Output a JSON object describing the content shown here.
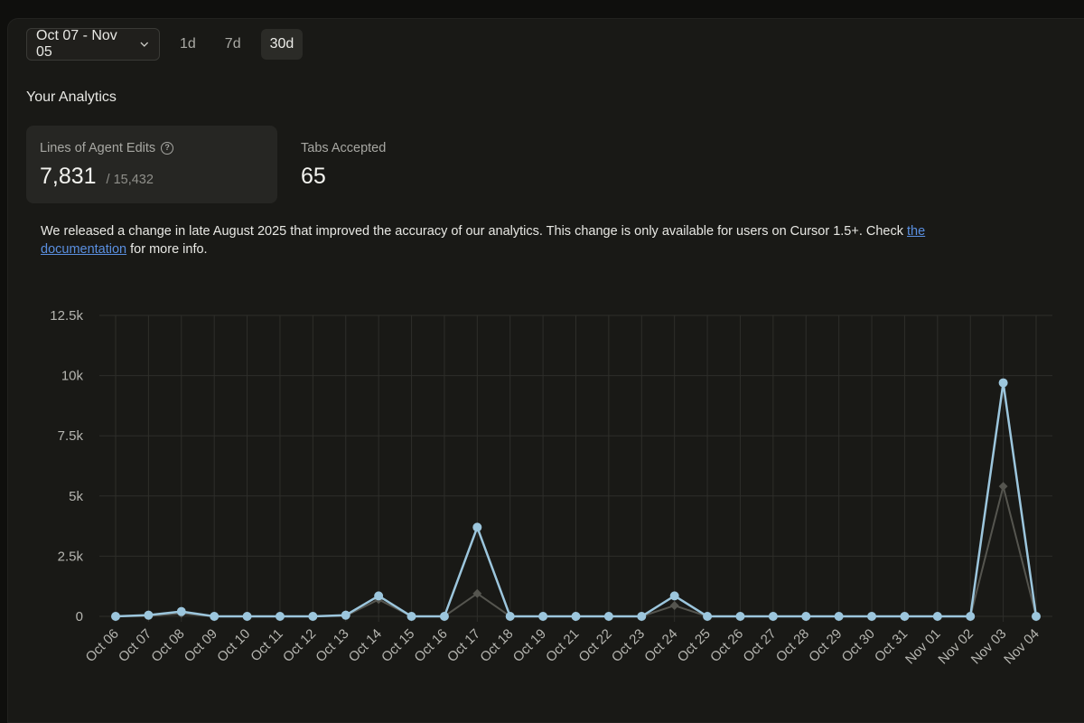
{
  "toolbar": {
    "range_label": "Oct 07 - Nov 05",
    "periods": [
      "1d",
      "7d",
      "30d"
    ],
    "active_period": "30d"
  },
  "analytics": {
    "title": "Your Analytics",
    "cards": [
      {
        "label": "Lines of Agent Edits",
        "value": "7,831",
        "total": "/ 15,432"
      },
      {
        "label": "Tabs Accepted",
        "value": "65"
      }
    ]
  },
  "notice": {
    "text_before": "We released a change in late August 2025 that improved the accuracy of our analytics. This change is only available for users on Cursor 1.5+. Check ",
    "link_text_1": "the",
    "link_text_2": "documentation",
    "text_after": " for more info."
  },
  "colors": {
    "accent_series": "#9cc6dd",
    "secondary_series": "#55554f",
    "link": "#5a8fe0"
  },
  "chart_data": {
    "type": "line",
    "x": [
      "Oct 06",
      "Oct 07",
      "Oct 08",
      "Oct 09",
      "Oct 10",
      "Oct 11",
      "Oct 12",
      "Oct 13",
      "Oct 14",
      "Oct 15",
      "Oct 16",
      "Oct 17",
      "Oct 18",
      "Oct 19",
      "Oct 21",
      "Oct 22",
      "Oct 23",
      "Oct 24",
      "Oct 25",
      "Oct 26",
      "Oct 27",
      "Oct 28",
      "Oct 29",
      "Oct 30",
      "Oct 31",
      "Nov 01",
      "Nov 02",
      "Nov 03",
      "Nov 04"
    ],
    "series": [
      {
        "values": [
          0,
          50,
          200,
          0,
          0,
          0,
          0,
          50,
          850,
          0,
          0,
          3700,
          0,
          0,
          0,
          0,
          0,
          850,
          0,
          0,
          0,
          0,
          0,
          0,
          0,
          0,
          0,
          9700,
          0
        ]
      },
      {
        "values": [
          0,
          20,
          120,
          0,
          0,
          0,
          0,
          20,
          700,
          0,
          0,
          950,
          0,
          0,
          0,
          0,
          0,
          450,
          0,
          0,
          0,
          0,
          0,
          0,
          0,
          0,
          0,
          5400,
          0
        ]
      }
    ],
    "yticks": [
      "0",
      "2.5k",
      "5k",
      "7.5k",
      "10k",
      "12.5k"
    ],
    "ylim": [
      0,
      12500
    ],
    "grid": true
  }
}
